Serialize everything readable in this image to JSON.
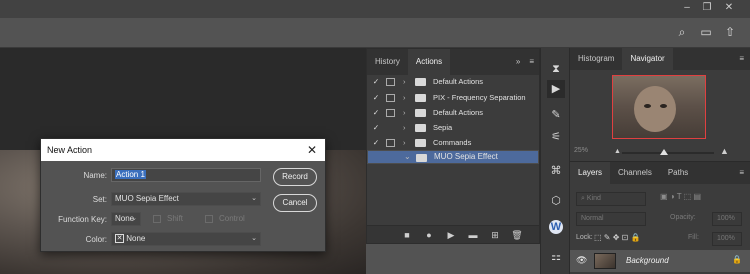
{
  "toolbar_icons": [
    "minimize-icon",
    "restore-icon",
    "close-icon",
    "search-icon",
    "workspace-icon",
    "share-icon"
  ],
  "actions_panel": {
    "tabs": [
      "History",
      "Actions"
    ],
    "active_tab": "Actions",
    "rows": [
      {
        "label": "Default Actions",
        "checked": true,
        "dialog": true,
        "selected": false
      },
      {
        "label": "PIX - Frequency Separation",
        "checked": true,
        "dialog": true,
        "selected": false
      },
      {
        "label": "Default Actions",
        "checked": true,
        "dialog": true,
        "selected": false
      },
      {
        "label": "Sepia",
        "checked": true,
        "dialog": false,
        "selected": false
      },
      {
        "label": "Commands",
        "checked": true,
        "dialog": true,
        "selected": false
      },
      {
        "label": "MUO Sepia Effect",
        "checked": false,
        "dialog": false,
        "selected": true
      }
    ]
  },
  "navigator": {
    "tabs": [
      "Histogram",
      "Navigator"
    ],
    "active_tab": "Navigator",
    "zoom": "25%"
  },
  "layers": {
    "tabs": [
      "Layers",
      "Channels",
      "Paths"
    ],
    "active_tab": "Layers",
    "search_placeholder": "Kind",
    "blend_mode": "Normal",
    "opacity_label": "Opacity:",
    "opacity_value": "100%",
    "lock_label": "Lock:",
    "fill_label": "Fill:",
    "fill_value": "100%",
    "layer_name": "Background"
  },
  "dialog": {
    "title": "New Action",
    "name_label": "Name:",
    "name_value": "Action 1",
    "set_label": "Set:",
    "set_value": "MUO Sepia Effect",
    "function_key_label": "Function Key:",
    "function_key_value": "None",
    "shift_label": "Shift",
    "control_label": "Control",
    "color_label": "Color:",
    "color_value": "None",
    "record_label": "Record",
    "cancel_label": "Cancel"
  },
  "colors": {
    "selection": "#4d6a9c",
    "highlight": "#3a6fbd",
    "navigator_box": "#e04040"
  }
}
